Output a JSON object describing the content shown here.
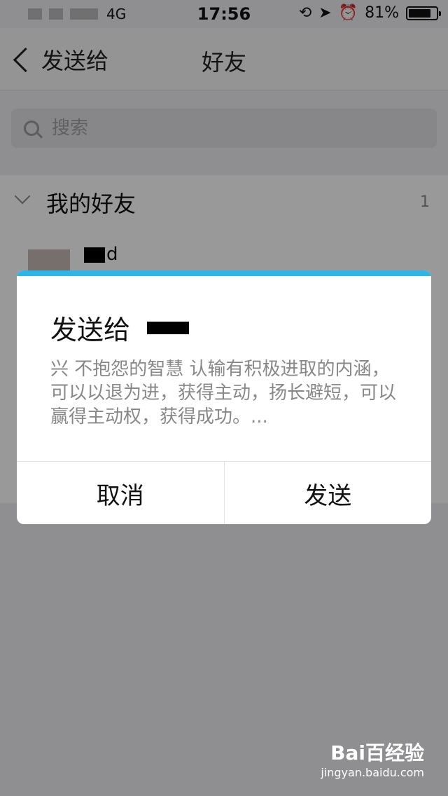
{
  "status_bar": {
    "network": "4G",
    "time": "17:56",
    "battery_percent": "81%",
    "battery_level": 0.81,
    "icons": [
      "orientation-lock-icon",
      "location-icon",
      "alarm-icon"
    ]
  },
  "nav": {
    "back_label": "发送给",
    "title": "好友"
  },
  "search": {
    "placeholder": "搜索"
  },
  "friends": {
    "group_name": "我的好友",
    "count": "1",
    "items": [
      {
        "name_visible": "d"
      }
    ]
  },
  "dialog": {
    "title_prefix": "发送给",
    "message": "兴 不抱怨的智慧 认输有积极进取的内涵，可以以退为进，获得主动，扬长避短，可以赢得主动权，获得成功。...",
    "cancel_label": "取消",
    "send_label": "发送",
    "accent_color": "#2cb6e8"
  },
  "watermark": {
    "brand": "Bai百经验",
    "url": "jingyan.baidu.com"
  }
}
